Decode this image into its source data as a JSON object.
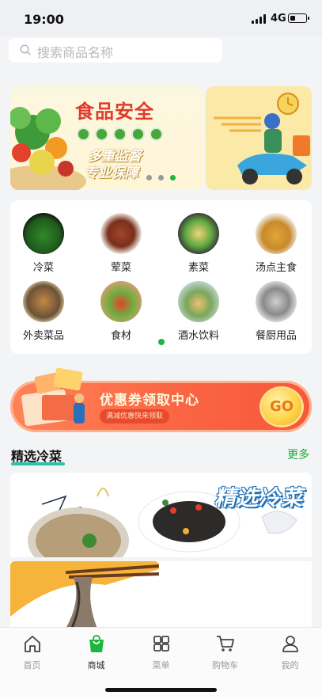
{
  "status_bar": {
    "time": "19:00",
    "network": "4G"
  },
  "search": {
    "placeholder": "搜索商品名称"
  },
  "banner": {
    "title": "食品安全",
    "line1": "多重监督",
    "line2": "专业保障",
    "slides": 3,
    "active_slide": 3
  },
  "categories": [
    {
      "label": "冷菜",
      "icon": "cold-dish-icon"
    },
    {
      "label": "荤菜",
      "icon": "meat-dish-icon"
    },
    {
      "label": "素菜",
      "icon": "veg-dish-icon"
    },
    {
      "label": "汤点主食",
      "icon": "soup-staple-icon"
    },
    {
      "label": "外卖菜品",
      "icon": "takeout-dish-icon"
    },
    {
      "label": "食材",
      "icon": "ingredients-icon"
    },
    {
      "label": "酒水饮料",
      "icon": "drinks-icon"
    },
    {
      "label": "餐厨用品",
      "icon": "kitchen-supplies-icon"
    }
  ],
  "coupon": {
    "title": "优惠券领取中心",
    "subtitle": "满减优惠快来领取",
    "go_label": "GO"
  },
  "section": {
    "title": "精选冷菜",
    "more_label": "更多"
  },
  "feature_banner": {
    "title": "精选冷菜"
  },
  "tabbar": [
    {
      "label": "首页",
      "icon": "home-icon",
      "active": false
    },
    {
      "label": "商城",
      "icon": "shop-bag-icon",
      "active": true
    },
    {
      "label": "菜单",
      "icon": "menu-grid-icon",
      "active": false
    },
    {
      "label": "购物车",
      "icon": "cart-icon",
      "active": false
    },
    {
      "label": "我的",
      "icon": "profile-icon",
      "active": false
    }
  ],
  "colors": {
    "accent_green": "#1bb63d",
    "banner_red": "#e1392c",
    "coupon_orange": "#fb6544",
    "underline_teal": "#33c0a8"
  }
}
